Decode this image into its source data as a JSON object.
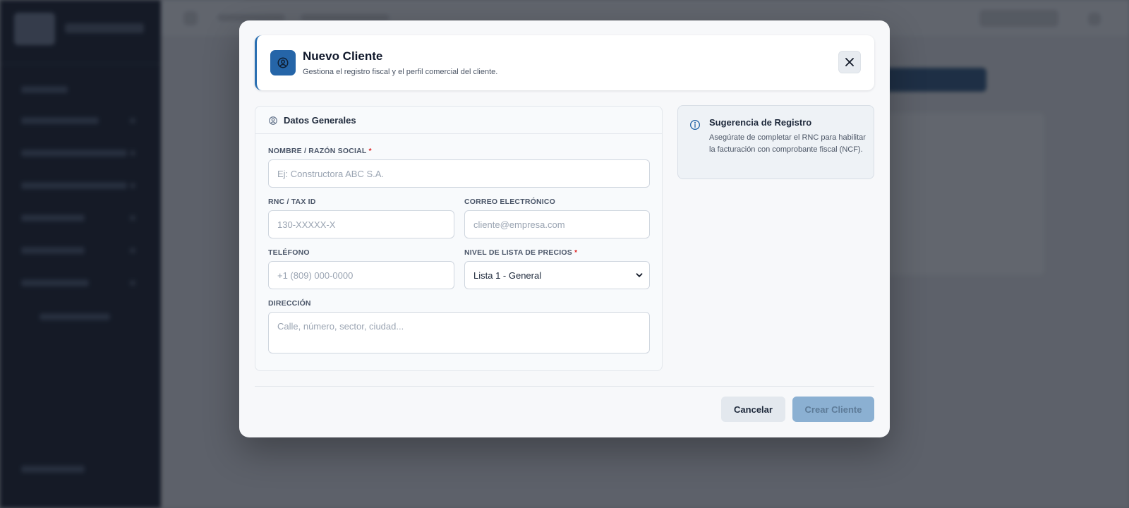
{
  "modal": {
    "title": "Nuevo Cliente",
    "subtitle": "Gestiona el registro fiscal y el perfil comercial del cliente.",
    "header_icon": "user-circle-icon",
    "close_icon": "close-icon"
  },
  "form": {
    "section_title": "Datos Generales",
    "section_icon": "user-circle-icon",
    "name": {
      "label": "NOMBRE / RAZÓN SOCIAL",
      "required": "*",
      "placeholder": "Ej: Constructora ABC S.A.",
      "value": ""
    },
    "rnc": {
      "label": "RNC / TAX ID",
      "placeholder": "130-XXXXX-X",
      "value": ""
    },
    "email": {
      "label": "CORREO ELECTRÓNICO",
      "placeholder": "cliente@empresa.com",
      "value": ""
    },
    "phone": {
      "label": "TELÉFONO",
      "placeholder": "+1 (809) 000-0000",
      "value": ""
    },
    "price_list": {
      "label": "NIVEL DE LISTA DE PRECIOS",
      "required": "*",
      "selected": "Lista 1 - General"
    },
    "address": {
      "label": "DIRECCIÓN",
      "placeholder": "Calle, número, sector, ciudad...",
      "value": ""
    }
  },
  "tip": {
    "icon": "info-icon",
    "title": "Sugerencia de Registro",
    "text": "Asegúrate de completar el RNC para habilitar la facturación con comprobante fiscal (NCF)."
  },
  "footer": {
    "cancel_label": "Cancelar",
    "create_label": "Crear Cliente"
  },
  "colors": {
    "accent": "#2565a8",
    "required": "#dc2626",
    "disabled_button": "#8bb0d2"
  }
}
